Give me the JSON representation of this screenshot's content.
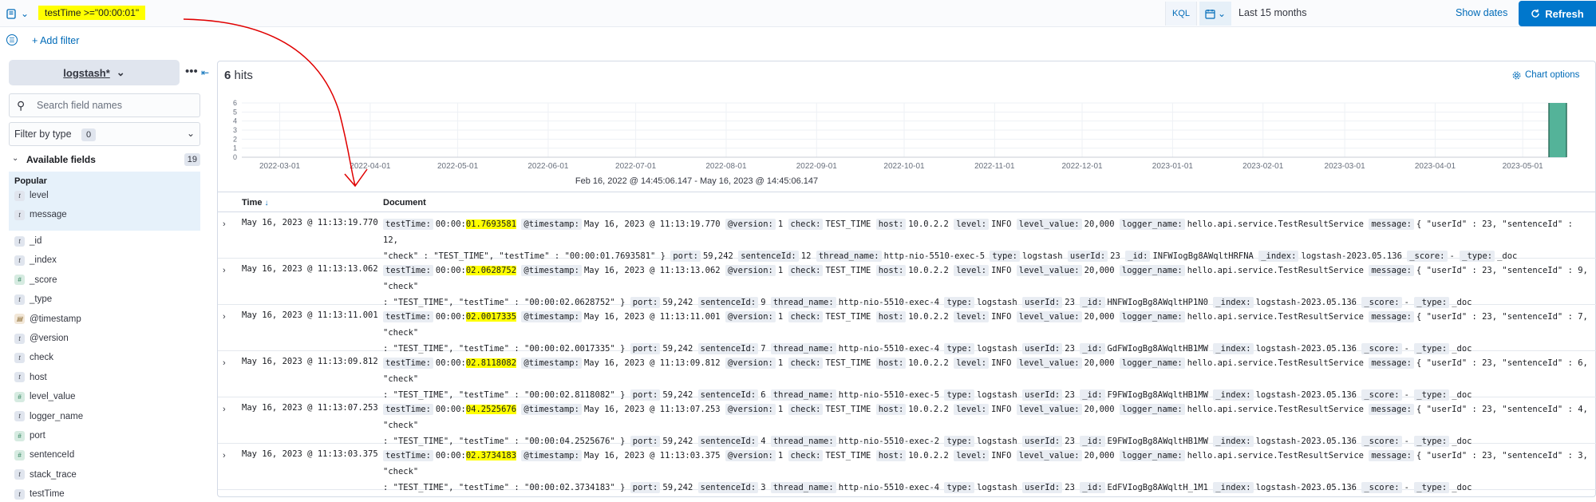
{
  "query": {
    "text": "testTime >=\"00:00:01\"",
    "language": "KQL"
  },
  "date": {
    "range": "Last 15 months",
    "show_dates": "Show dates",
    "refresh": "Refresh"
  },
  "filters": {
    "add_filter": "+ Add filter"
  },
  "sidebar": {
    "index_pattern": "logstash*",
    "search_placeholder": "Search field names",
    "filter_by_type": "Filter by type",
    "filter_count": "0",
    "available_fields": "Available fields",
    "available_count": "19",
    "popular_title": "Popular",
    "popular": [
      {
        "name": "level",
        "type": "t"
      },
      {
        "name": "message",
        "type": "t"
      }
    ],
    "fields": [
      {
        "name": "_id",
        "type": "t"
      },
      {
        "name": "_index",
        "type": "t"
      },
      {
        "name": "_score",
        "type": "#"
      },
      {
        "name": "_type",
        "type": "t"
      },
      {
        "name": "@timestamp",
        "type": "date"
      },
      {
        "name": "@version",
        "type": "t"
      },
      {
        "name": "check",
        "type": "t"
      },
      {
        "name": "host",
        "type": "t"
      },
      {
        "name": "level_value",
        "type": "#"
      },
      {
        "name": "logger_name",
        "type": "t"
      },
      {
        "name": "port",
        "type": "#"
      },
      {
        "name": "sentenceId",
        "type": "#"
      },
      {
        "name": "stack_trace",
        "type": "t"
      },
      {
        "name": "testTime",
        "type": "t"
      }
    ]
  },
  "results": {
    "hits_count": "6",
    "hits_label": "hits",
    "chart_options": "Chart options",
    "time_range": "Feb 16, 2022 @ 14:45:06.147 - May 16, 2023 @ 14:45:06.147",
    "col_time": "Time",
    "col_document": "Document",
    "rows": [
      {
        "time": "May 16, 2023 @ 11:13:19.770",
        "testTime_prefix": "00:00:",
        "testTime_hl": "01.7693581",
        "sentenceId": "12",
        "thread": "http-nio-5510-exec-5",
        "id": "INFWIogBg8AWqltHRFNA",
        "msg_line1": "{ \"userId\" : 23, \"sentenceId\" : 12,",
        "msg_line2": "\"check\" : \"TEST_TIME\", \"testTime\" : \"00:00:01.7693581\" }"
      },
      {
        "time": "May 16, 2023 @ 11:13:13.062",
        "testTime_prefix": "00:00:",
        "testTime_hl": "02.0628752",
        "sentenceId": "9",
        "thread": "http-nio-5510-exec-4",
        "id": "HNFWIogBg8AWqltHP1N0",
        "msg_line1": "{ \"userId\" : 23, \"sentenceId\" : 9, \"check\"",
        "msg_line2": ": \"TEST_TIME\", \"testTime\" : \"00:00:02.0628752\" }"
      },
      {
        "time": "May 16, 2023 @ 11:13:11.001",
        "testTime_prefix": "00:00:",
        "testTime_hl": "02.0017335",
        "sentenceId": "7",
        "thread": "http-nio-5510-exec-4",
        "id": "GdFWIogBg8AWqltHB1MW",
        "msg_line1": "{ \"userId\" : 23, \"sentenceId\" : 7, \"check\"",
        "msg_line2": ": \"TEST_TIME\", \"testTime\" : \"00:00:02.0017335\" }"
      },
      {
        "time": "May 16, 2023 @ 11:13:09.812",
        "testTime_prefix": "00:00:",
        "testTime_hl": "02.8118082",
        "sentenceId": "6",
        "thread": "http-nio-5510-exec-5",
        "id": "F9FWIogBg8AWqltHB1MW",
        "msg_line1": "{ \"userId\" : 23, \"sentenceId\" : 6, \"check\"",
        "msg_line2": ": \"TEST_TIME\", \"testTime\" : \"00:00:02.8118082\" }"
      },
      {
        "time": "May 16, 2023 @ 11:13:07.253",
        "testTime_prefix": "00:00:",
        "testTime_hl": "04.2525676",
        "sentenceId": "4",
        "thread": "http-nio-5510-exec-2",
        "id": "E9FWIogBg8AWqltHB1MW",
        "msg_line1": "{ \"userId\" : 23, \"sentenceId\" : 4, \"check\"",
        "msg_line2": ": \"TEST_TIME\", \"testTime\" : \"00:00:04.2525676\" }"
      },
      {
        "time": "May 16, 2023 @ 11:13:03.375",
        "testTime_prefix": "00:00:",
        "testTime_hl": "02.3734183",
        "sentenceId": "3",
        "thread": "http-nio-5510-exec-4",
        "id": "EdFVIogBg8AWqltH_1M1",
        "msg_line1": "{ \"userId\" : 23, \"sentenceId\" : 3, \"check\"",
        "msg_line2": ": \"TEST_TIME\", \"testTime\" : \"00:00:02.3734183\" }"
      }
    ],
    "common": {
      "version": "1",
      "check": "TEST_TIME",
      "host": "10.0.2.2",
      "level": "INFO",
      "level_value": "20,000",
      "logger_name": "hello.api.service.TestResultService",
      "port": "59,242",
      "type": "logstash",
      "userId": "23",
      "index": "logstash-2023.05.136",
      "score": "-",
      "_type": "_doc"
    },
    "keys": {
      "testTime": "testTime:",
      "timestamp": "@timestamp:",
      "version": "@version:",
      "check": "check:",
      "host": "host:",
      "level": "level:",
      "level_value": "level_value:",
      "logger_name": "logger_name:",
      "message": "message:",
      "port": "port:",
      "sentenceId": "sentenceId:",
      "thread_name": "thread_name:",
      "type": "type:",
      "userId": "userId:",
      "_id": "_id:",
      "_index": "_index:",
      "_score": "_score:",
      "_type": "_type:"
    }
  },
  "chart_data": {
    "type": "bar",
    "categories": [
      "2022-03-01",
      "2022-04-01",
      "2022-05-01",
      "2022-06-01",
      "2022-07-01",
      "2022-08-01",
      "2022-09-01",
      "2022-10-01",
      "2022-11-01",
      "2022-12-01",
      "2023-01-01",
      "2023-02-01",
      "2023-03-01",
      "2023-04-01",
      "2023-05-01"
    ],
    "x_range": [
      "2022-02-16",
      "2023-05-16"
    ],
    "values_by_date": [
      {
        "date": "2023-05-16",
        "value": 6
      }
    ],
    "yticks": [
      0,
      1,
      2,
      3,
      4,
      5,
      6
    ],
    "ylim": [
      0,
      6
    ],
    "bar_color": "#54b399",
    "grid": true
  }
}
